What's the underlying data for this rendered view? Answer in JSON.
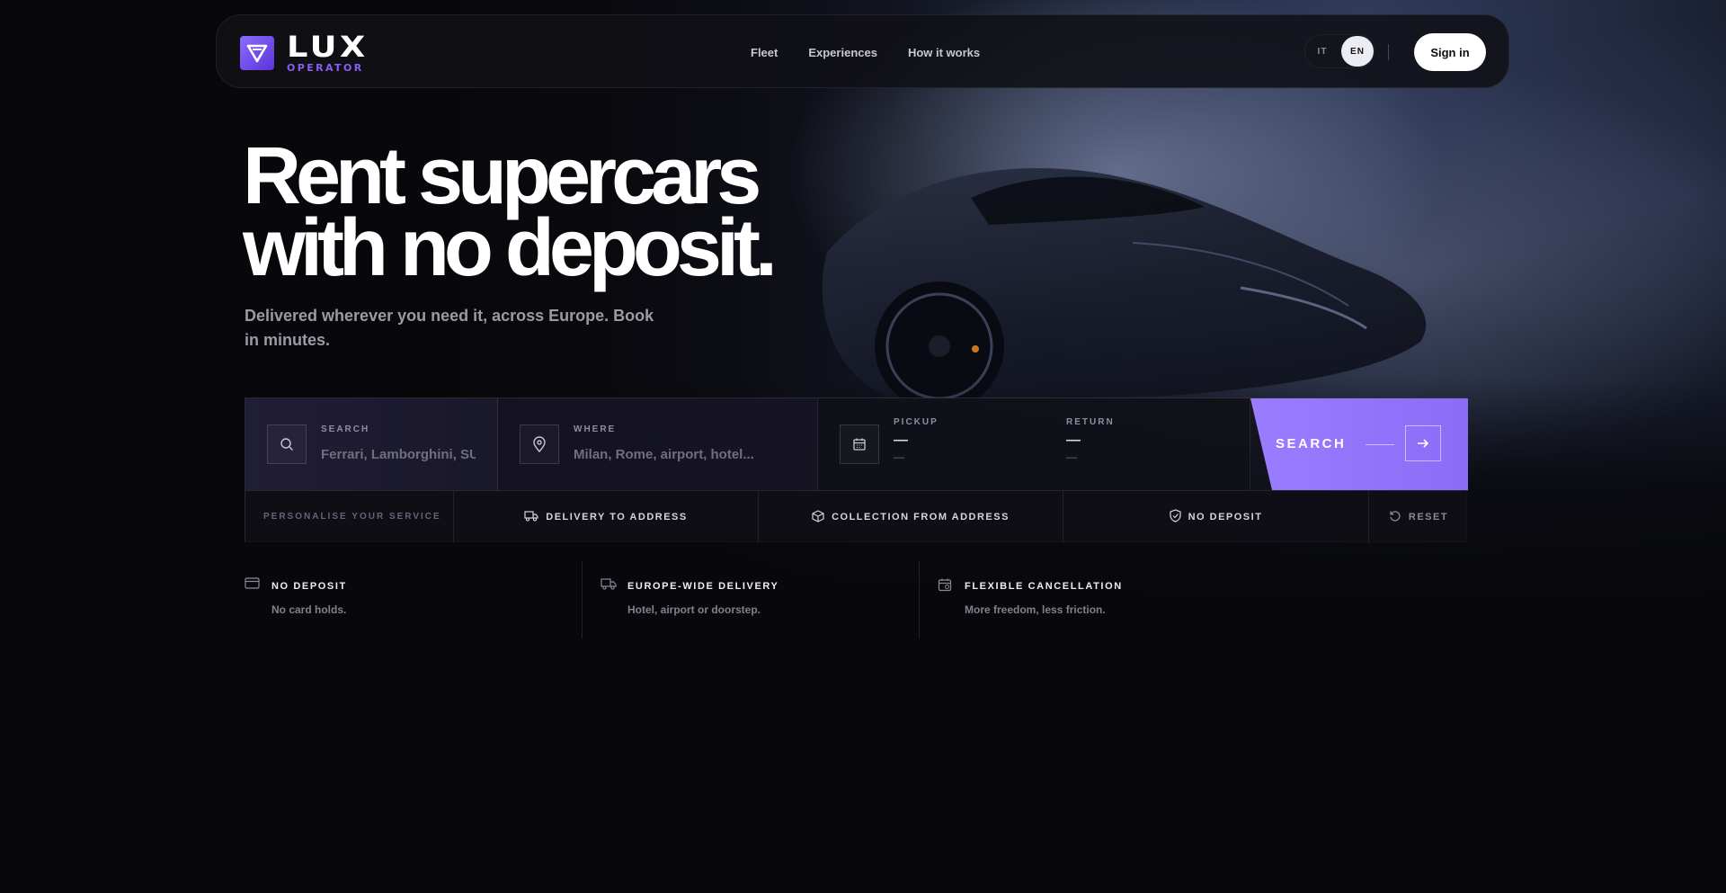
{
  "brand": {
    "name": "LUX",
    "tagline": "OPERATOR",
    "accent_color": "#8b5cf6"
  },
  "nav": {
    "links": [
      "Fleet",
      "Experiences",
      "How it works"
    ],
    "languages": [
      "IT",
      "EN"
    ],
    "active_language": "EN",
    "signin_label": "Sign in"
  },
  "hero": {
    "headline_line1": "Rent supercars",
    "headline_line2": "with no deposit.",
    "subtitle": "Delivered wherever you need it, across Europe. Book in minutes."
  },
  "search": {
    "search_label": "SEARCH",
    "search_placeholder": "Ferrari, Lamborghini, SUV...",
    "where_label": "WHERE",
    "where_placeholder": "Milan, Rome, airport, hotel...",
    "pickup_label": "PICKUP",
    "pickup_value": "—",
    "pickup_sub": "—",
    "return_label": "RETURN",
    "return_value": "—",
    "return_sub": "—",
    "button_label": "SEARCH"
  },
  "options": {
    "label": "PERSONALISE YOUR SERVICE",
    "delivery": "DELIVERY TO ADDRESS",
    "collection": "COLLECTION FROM ADDRESS",
    "no_deposit": "NO DEPOSIT",
    "reset": "RESET"
  },
  "features": [
    {
      "title": "NO DEPOSIT",
      "desc": "No card holds.",
      "icon": "credit-card-icon"
    },
    {
      "title": "EUROPE-WIDE DELIVERY",
      "desc": "Hotel, airport or doorstep.",
      "icon": "truck-icon"
    },
    {
      "title": "FLEXIBLE CANCELLATION",
      "desc": "More freedom, less friction.",
      "icon": "calendar-icon"
    }
  ]
}
